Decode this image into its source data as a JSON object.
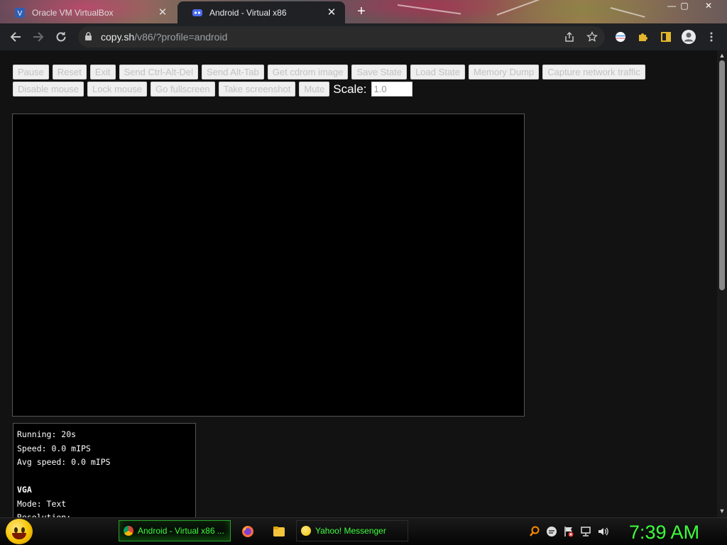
{
  "browser": {
    "tabs": [
      {
        "title": "Oracle VM VirtualBox",
        "active": false
      },
      {
        "title": "Android - Virtual x86",
        "active": true
      }
    ],
    "new_tab_label": "+",
    "window_controls": {
      "minimize": "—",
      "maximize": "▢",
      "close": "✕"
    },
    "tab_close_glyph": "✕",
    "url": {
      "host": "copy.sh",
      "path": "/v86/?profile=android"
    }
  },
  "page": {
    "buttons_row1": [
      "Pause",
      "Reset",
      "Exit",
      "Send Ctrl-Alt-Del",
      "Send Alt-Tab",
      "Get cdrom image",
      "Save State",
      "Load State",
      "Memory Dump",
      "Capture network traffic"
    ],
    "buttons_row2": [
      "Disable mouse",
      "Lock mouse",
      "Go fullscreen",
      "Take screenshot",
      "Mute"
    ],
    "scale_label": "Scale:",
    "scale_value": "1.0",
    "info_lines": [
      {
        "text": "Running: 20s",
        "bold": false
      },
      {
        "text": "Speed: 0.0 mIPS",
        "bold": false
      },
      {
        "text": "Avg speed: 0.0 mIPS",
        "bold": false
      },
      {
        "text": "",
        "bold": false
      },
      {
        "text": "VGA",
        "bold": true
      },
      {
        "text": "Mode: Text",
        "bold": false
      },
      {
        "text": "Resolution: -",
        "bold": false
      }
    ]
  },
  "taskbar": {
    "tasks": [
      {
        "label": "Android - Virtual x86 ...",
        "icon": "chrome-icon",
        "active": true
      },
      {
        "label": "Yahoo! Messenger",
        "icon": "yahoo-messenger-icon",
        "active": false
      }
    ],
    "clock": "7:39 AM"
  },
  "colors": {
    "taskbar_text": "#3dff3d",
    "page_background": "#121212",
    "toolbar_background": "#202124"
  }
}
